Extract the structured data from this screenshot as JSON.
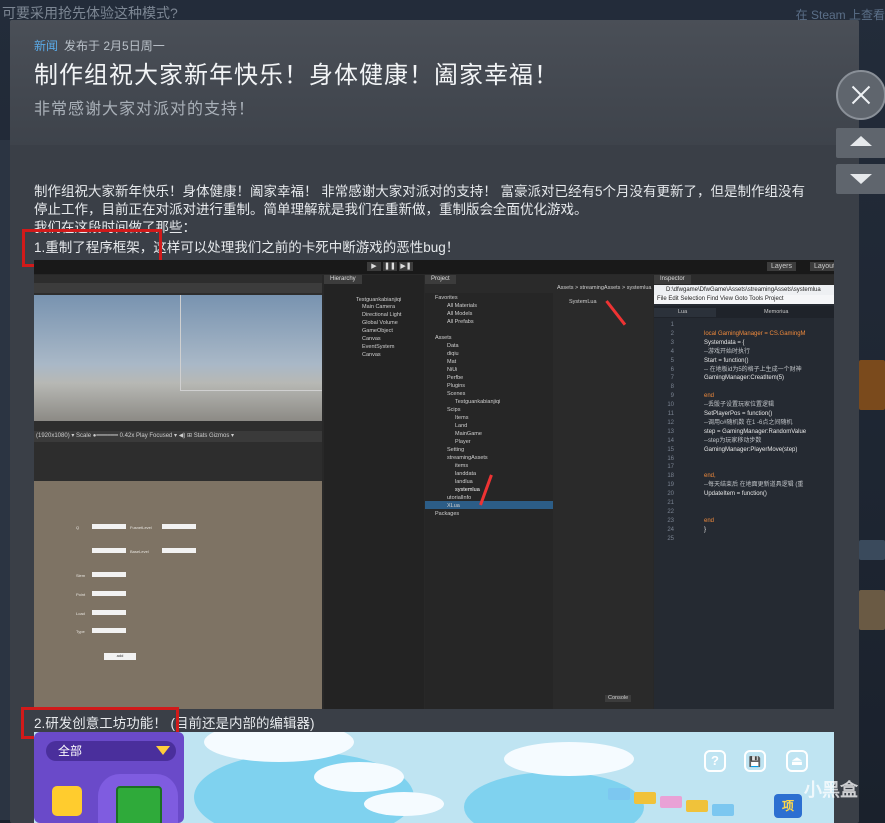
{
  "backdrop": {
    "top_text": "可要采用抢先体验这种模式?",
    "right_text": "在 Steam 上查看"
  },
  "post": {
    "tag": "新闻",
    "date": "发布于 2月5日周一",
    "title": "制作组祝大家新年快乐！身体健康！阖家幸福！",
    "subtitle": "非常感谢大家对派对的支持！",
    "paragraph_line1": "制作组祝大家新年快乐！身体健康！阖家幸福！ 非常感谢大家对派对的支持！ 富豪派对已经有5个月没有更新了，但是制作组没有",
    "paragraph_line2": "停止工作，目前正在对派对进行重制。简单理解就是我们在重新做，重制版会全面优化游戏。",
    "paragraph_line3": "我们在这段时间做了那些：",
    "item1": "1.重制了程序框架，这样可以处理我们之前的卡死中断游戏的恶性bug！",
    "item2_main": "2.研发创意工坊功能！",
    "item2_note": "(目前还是内部的编辑器)"
  },
  "editor": {
    "layers_label": "Layers",
    "layout_label": "Layout",
    "hierarchy_tab": "Hierarchy",
    "project_tab": "Project",
    "inspector_tab": "Inspector",
    "scene_root": "Testguankabianjiqi",
    "hierarchy_items": [
      "Main Camera",
      "Directional Light",
      "Global Volume",
      "GameObject",
      "Canvas",
      "EventSystem",
      "Canvas"
    ],
    "favorites_label": "Favorites",
    "favorites": [
      "All Materials",
      "All Models",
      "All Prefabs"
    ],
    "assets_label": "Assets",
    "asset_items": [
      "Data",
      "diqiu",
      "Mat",
      "NiUi",
      "Perfbe",
      "Plugins",
      "Scenes",
      "Testguankabianjiqi",
      "Scips",
      "Items",
      "Land",
      "MainGame",
      "Player",
      "Setting",
      "streamingAssets",
      "items",
      "landdata",
      "landlua",
      "systemlua",
      "utorialInfo",
      "XLua",
      "Packages"
    ],
    "breadcrumb": "Assets > streamingAssets > systemlua",
    "file_name": "SystemLua",
    "game_bar": "(1920x1080)  ▾  Scale ●━━━━━━  0.42x  Play Focused  ▾  ◀)  ⊞  Stats  Gizmos  ▾",
    "console_label": "Console",
    "code_title": "D:\\dfwgame\\DfwGame\\Assets\\streamingAssets\\systemlua",
    "code_menu": "File  Edit  Selection  Find  View  Goto  Tools  Project",
    "code_tab1": "Lua",
    "code_tab2": "Memoriua",
    "line_numbers": [
      "1",
      "2",
      "3",
      "4",
      "5",
      "6",
      "7",
      "8",
      "9",
      "10",
      "11",
      "12",
      "13",
      "14",
      "15",
      "16",
      "17",
      "18",
      "19",
      "20",
      "21",
      "22",
      "23",
      "24",
      "25"
    ],
    "code_lines": [
      "",
      "local GamingManager = CS.GamingM",
      "Systemdata = {",
      "--游戏开始时执行",
      "Start = function()",
      "-- 在地板id为5的格子上生成一个财神",
      "GamingManager:CreatItem(5)",
      "",
      "end",
      "--丢骰子设置玩家位置逻辑",
      "SetPlayerPos = function()",
      "--调用c#随机数 在1 -6点之间随机",
      "step = GamingManager:RandomValue",
      "--step为玩家移动步数",
      "GamingManager:PlayerMove(step)",
      "",
      "",
      "end,",
      "--每天结束后 在地面更新道具逻辑 (重",
      "UpdateItem = function()",
      "",
      "",
      "end",
      "}",
      ""
    ],
    "game_labels": [
      "Q",
      "FusnetLevel",
      "BaseLevel",
      "Siem",
      "Point",
      "Load",
      "Type",
      "add"
    ]
  },
  "game_image": {
    "dropdown_label": "全部",
    "icon_help": "?",
    "icon_save": "💾",
    "icon_exit": "⏏",
    "badge": "项",
    "watermark": "小黑盒"
  },
  "controls": {
    "close_label": "close",
    "up_label": "previous",
    "down_label": "next"
  },
  "colors": {
    "accent": "#5aa9e6",
    "highlight_box": "#d11a1a",
    "modal_bg": "#3a3f47"
  }
}
